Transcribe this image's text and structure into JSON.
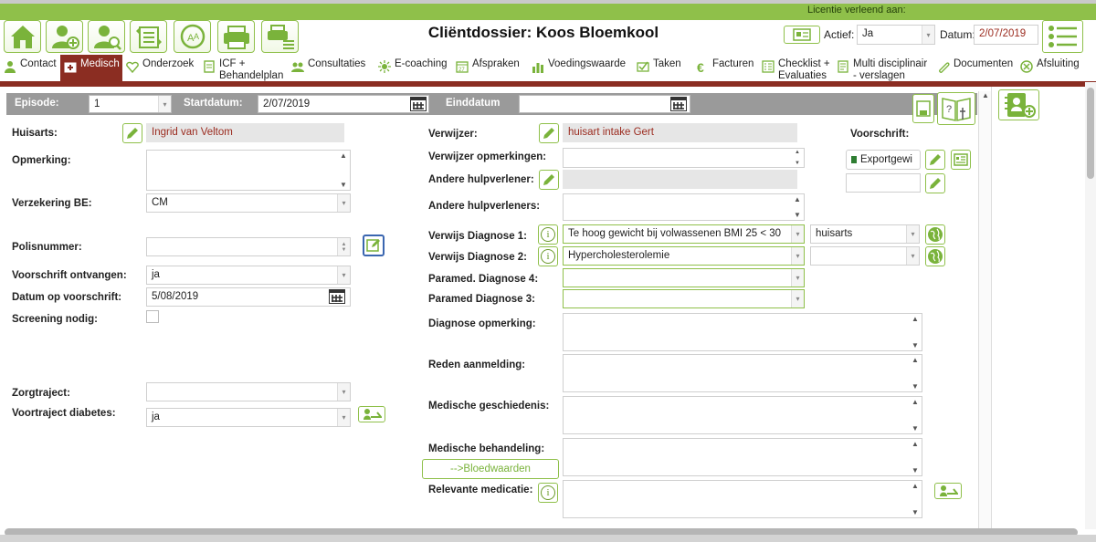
{
  "license": {
    "text": "Licentie verleend aan:"
  },
  "header": {
    "title": "Cliëntdossier:  Koos  Bloemkool",
    "active_label": "Actief:",
    "active_value": "Ja",
    "date_label": "Datum:",
    "date_value": "2/07/2019"
  },
  "toolbar": {
    "icons": [
      "home-icon",
      "add-user-icon",
      "search-user-icon",
      "transfer-list-icon",
      "refresh-font-icon",
      "print-user-icon",
      "print-list-icon"
    ]
  },
  "tabs": [
    {
      "label": "Contact",
      "icon": "person-icon"
    },
    {
      "label": "Medisch",
      "icon": "medical-kit-icon",
      "active": true
    },
    {
      "label": "Onderzoek",
      "icon": "heart-icon"
    },
    {
      "label": "ICF +",
      "label2": "Behandelplan",
      "icon": "document-icon"
    },
    {
      "label": "Consultaties",
      "icon": "group-icon"
    },
    {
      "label": "E-coaching",
      "icon": "sun-icon"
    },
    {
      "label": "Afspraken",
      "icon": "calendar-icon"
    },
    {
      "label": "Voedingswaarde",
      "icon": "bar-chart-icon"
    },
    {
      "label": "Taken",
      "icon": "check-mail-icon"
    },
    {
      "label": "Facturen",
      "icon": "euro-icon"
    },
    {
      "label": "Checklist +",
      "label2": "Evaluaties",
      "icon": "checklist-icon"
    },
    {
      "label": "Multi disciplinair",
      "label2": "- verslagen",
      "icon": "report-icon"
    },
    {
      "label": "Documenten",
      "icon": "paperclip-icon"
    },
    {
      "label": "Afsluiting",
      "icon": "close-circle-icon"
    }
  ],
  "episode": {
    "label": "Episode:",
    "value": "1",
    "start_label": "Startdatum:",
    "start_value": "2/07/2019",
    "end_label": "Einddatum",
    "end_value": ""
  },
  "left": {
    "huisarts_label": "Huisarts:",
    "huisarts_value": "Ingrid van Veltom",
    "opmerking_label": "Opmerking:",
    "verzekering_label": "Verzekering BE:",
    "verzekering_value": "CM",
    "polis_label": "Polisnummer:",
    "voorschrift_ontv_label": "Voorschrift ontvangen:",
    "voorschrift_ontv_value": "ja",
    "datum_voorschrift_label": "Datum op voorschrift:",
    "datum_voorschrift_value": "5/08/2019",
    "screening_label": "Screening nodig:",
    "zorgtraject_label": "Zorgtraject:",
    "voortraject_label": "Voortraject diabetes:",
    "voortraject_value": "ja"
  },
  "middle": {
    "verwijzer_label": "Verwijzer:",
    "verwijzer_value": "huisart intake  Gert",
    "verwijzer_opm_label": "Verwijzer opmerkingen:",
    "andere_hv_label": "Andere hulpverlener:",
    "andere_hvs_label": "Andere  hulpverleners:",
    "diag1_label": "Verwijs Diagnose 1:",
    "diag1_value": "Te hoog gewicht bij volwassenen BMI 25 < 30",
    "diag1_source": "huisarts",
    "diag2_label": "Verwijs Diagnose 2:",
    "diag2_value": "Hypercholesterolemie",
    "diag2_source": "",
    "param4_label": "Paramed. Diagnose 4:",
    "param3_label": "Paramed Diagnose 3:",
    "diag_opm_label": "Diagnose opmerking:",
    "reden_label": "Reden aanmelding:",
    "geschiedenis_label": "Medische  geschiedenis:",
    "behandeling_label": "Medische  behandeling:",
    "bloedwaarden_label": "-->Bloedwaarden",
    "medicatie_label": "Relevante  medicatie:"
  },
  "right": {
    "voorschrift_label": "Voorschrift:",
    "export_label": "Exportgewi"
  }
}
